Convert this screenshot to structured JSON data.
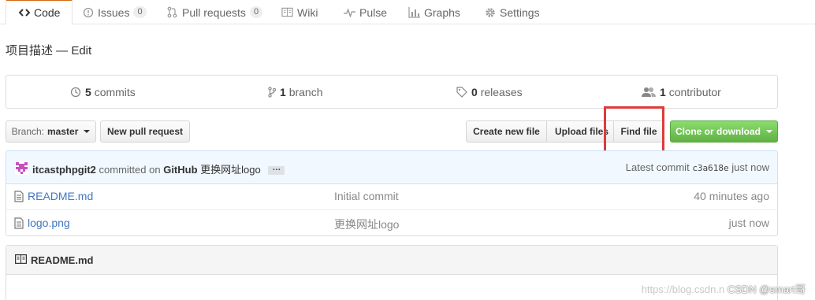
{
  "tabs": [
    {
      "label": "Code",
      "icon": "code-icon"
    },
    {
      "label": "Issues",
      "count": "0",
      "icon": "issue-icon"
    },
    {
      "label": "Pull requests",
      "count": "0",
      "icon": "pull-request-icon"
    },
    {
      "label": "Wiki",
      "icon": "book-icon"
    },
    {
      "label": "Pulse",
      "icon": "pulse-icon"
    },
    {
      "label": "Graphs",
      "icon": "graph-icon"
    },
    {
      "label": "Settings",
      "icon": "gear-icon"
    }
  ],
  "page_title": "项目描述 — Edit",
  "summary": {
    "commits": {
      "num": "5",
      "label": "commits"
    },
    "branches": {
      "num": "1",
      "label": "branch"
    },
    "releases": {
      "num": "0",
      "label": "releases"
    },
    "contributors": {
      "num": "1",
      "label": "contributor"
    }
  },
  "toolbar": {
    "branch_prefix": "Branch:",
    "branch_name": "master",
    "new_pull_request": "New pull request",
    "create_new_file": "Create new file",
    "upload_files": "Upload files",
    "find_file": "Find file",
    "clone_or_download": "Clone or download"
  },
  "commit": {
    "author": "itcastphpgit2",
    "committed_on": "committed on",
    "platform": "GitHub",
    "message": "更换网址logo",
    "ellipsis": "…",
    "latest_label": "Latest commit",
    "sha": "c3a618e",
    "age": "just now"
  },
  "files": [
    {
      "name": "README.md",
      "message": "Initial commit",
      "age": "40 minutes ago",
      "icon": "file-icon"
    },
    {
      "name": "logo.png",
      "message": "更换网址logo",
      "age": "just now",
      "icon": "file-icon"
    }
  ],
  "readme": {
    "title": "README.md",
    "icon": "book-icon"
  },
  "watermark": {
    "url": "https://blog.csdn.n",
    "credit": "CSDN @smart哥"
  },
  "colors": {
    "accent": "#d26911",
    "link": "#4078c0",
    "green": "#6cc644",
    "highlight": "#e03a3a"
  }
}
